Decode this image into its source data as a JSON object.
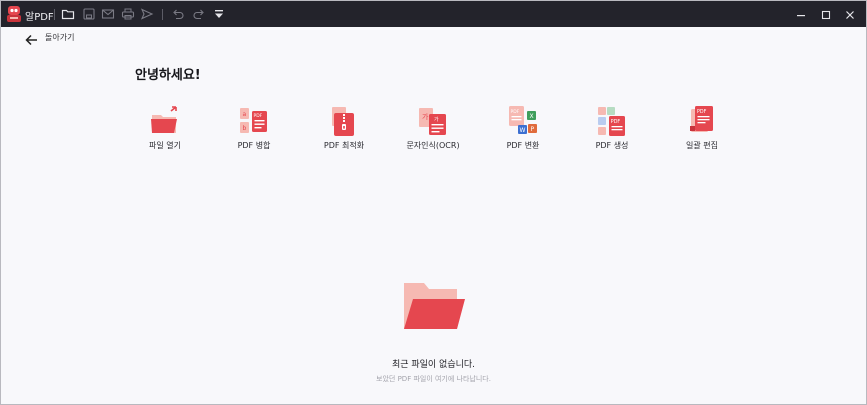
{
  "titlebar": {
    "app_name": "알PDF",
    "icons": [
      "open-folder-icon",
      "save-icon",
      "mail-icon",
      "print-icon",
      "share-icon",
      "undo-icon",
      "redo-icon",
      "quick-access-dropdown-icon"
    ],
    "window_controls": [
      "minimize-icon",
      "maximize-icon",
      "close-icon"
    ]
  },
  "nav": {
    "back_label": "돌아가기"
  },
  "main": {
    "greeting": "안녕하세요!",
    "tools": [
      {
        "label": "파일 열기",
        "icon": "folder-open-icon"
      },
      {
        "label": "PDF 병합",
        "icon": "merge-pdf-icon"
      },
      {
        "label": "PDF 최적화",
        "icon": "compress-pdf-icon"
      },
      {
        "label": "문자인식(OCR)",
        "icon": "ocr-icon"
      },
      {
        "label": "PDF 변환",
        "icon": "convert-pdf-icon"
      },
      {
        "label": "PDF 생성",
        "icon": "create-pdf-icon"
      },
      {
        "label": "일괄 편집",
        "icon": "batch-edit-icon"
      }
    ]
  },
  "recent": {
    "empty_title": "최근 파일이 없습니다.",
    "empty_subtitle": "보았던 PDF 파일이 여기에 나타납니다."
  },
  "colors": {
    "titlebar_bg": "#23232b",
    "background": "#f8f8fb",
    "accent_red": "#e5474f",
    "accent_light": "#f6b9b2"
  }
}
